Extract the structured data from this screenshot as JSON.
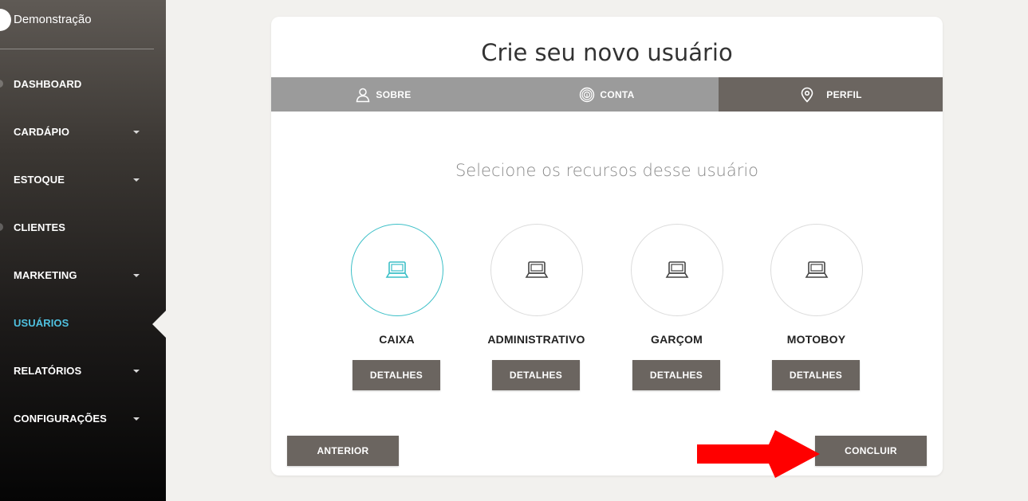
{
  "sidebar": {
    "title": "Demonstração",
    "items": [
      {
        "label": "DASHBOARD"
      },
      {
        "label": "CARDÁPIO"
      },
      {
        "label": "ESTOQUE"
      },
      {
        "label": "CLIENTES"
      },
      {
        "label": "MARKETING"
      },
      {
        "label": "USUÁRIOS"
      },
      {
        "label": "RELATÓRIOS"
      },
      {
        "label": "CONFIGURAÇÕES"
      }
    ],
    "active_item": "USUÁRIOS",
    "active_color": "#4fc1e0"
  },
  "wizard": {
    "title": "Crie seu novo usuário",
    "tabs": [
      {
        "label": "SOBRE",
        "icon": "user-icon"
      },
      {
        "label": "CONTA",
        "icon": "fingerprint-icon"
      },
      {
        "label": "PERFIL",
        "icon": "location-pin-icon"
      }
    ],
    "active_tab": "PERFIL",
    "subtitle": "Selecione os recursos desse usuário",
    "roles": [
      {
        "label": "CAIXA",
        "details": "DETALHES",
        "icon": "laptop-icon",
        "selected": true
      },
      {
        "label": "ADMINISTRATIVO",
        "details": "DETALHES",
        "icon": "laptop-icon",
        "selected": false
      },
      {
        "label": "GARÇOM",
        "details": "DETALHES",
        "icon": "laptop-icon",
        "selected": false
      },
      {
        "label": "MOTOBOY",
        "details": "DETALHES",
        "icon": "laptop-icon",
        "selected": false
      }
    ],
    "prev_label": "ANTERIOR",
    "finish_label": "CONCLUIR"
  },
  "colors": {
    "accent_teal": "#3bbfc7",
    "button_bg": "#6b6560",
    "annotation_arrow": "#ff0000"
  }
}
